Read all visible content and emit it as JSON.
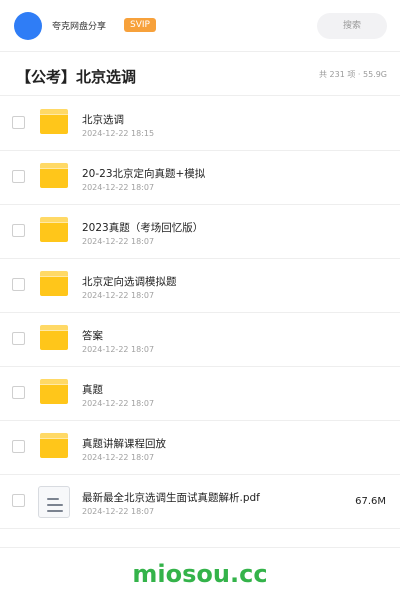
{
  "header": {
    "account_name": "夸克网盘分享",
    "badge": "SVIP",
    "search_label": "搜索"
  },
  "folder": {
    "title": "【公考】北京选调",
    "stats": "共 231 项 · 55.9G"
  },
  "items": [
    {
      "type": "folder",
      "name": "北京选调",
      "date": "2024-12-22 18:15",
      "size": ""
    },
    {
      "type": "folder",
      "name": "20-23北京定向真题+模拟",
      "date": "2024-12-22 18:07",
      "size": ""
    },
    {
      "type": "folder",
      "name": "2023真题（考场回忆版）",
      "date": "2024-12-22 18:07",
      "size": ""
    },
    {
      "type": "folder",
      "name": "北京定向选调模拟题",
      "date": "2024-12-22 18:07",
      "size": ""
    },
    {
      "type": "folder",
      "name": "答案",
      "date": "2024-12-22 18:07",
      "size": ""
    },
    {
      "type": "folder",
      "name": "真题",
      "date": "2024-12-22 18:07",
      "size": ""
    },
    {
      "type": "folder",
      "name": "真题讲解课程回放",
      "date": "2024-12-22 18:07",
      "size": ""
    },
    {
      "type": "file",
      "name": "最新最全北京选调生面试真题解析.pdf",
      "date": "2024-12-22 18:07",
      "size": "67.6M"
    }
  ],
  "watermark": "miosou.cc",
  "colors": {
    "avatar": "#2f7df6",
    "badge": "#f7a13b",
    "folder": "#ffc61a",
    "watermark": "#34b34a"
  }
}
